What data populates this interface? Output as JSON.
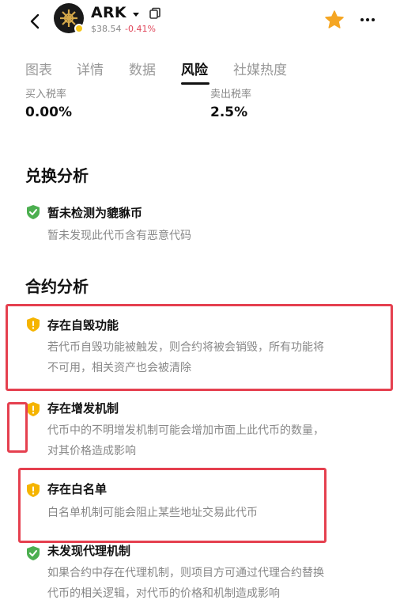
{
  "header": {
    "token_name": "ARK",
    "price": "$38.54",
    "change": "-0.41%",
    "colors": {
      "star": "#f5a623",
      "negative": "#e0465a",
      "shield_warn": "#f5b400",
      "shield_ok": "#4caf50",
      "annotation": "#e5404f"
    }
  },
  "tabs": [
    {
      "label": "图表"
    },
    {
      "label": "详情"
    },
    {
      "label": "数据"
    },
    {
      "label": "风险"
    },
    {
      "label": "社媒热度"
    }
  ],
  "tax": {
    "buy_label": "买入税率",
    "buy_value": "0.00%",
    "sell_label": "卖出税率",
    "sell_value": "2.5%"
  },
  "exchange_analysis": {
    "title": "兑换分析",
    "items": [
      {
        "status": "ok",
        "title": "暂未检测为貔貅币",
        "desc": [
          "暂未发现此代币含有恶意代码"
        ]
      }
    ]
  },
  "contract_analysis": {
    "title": "合约分析",
    "items": [
      {
        "status": "warn",
        "title": "存在自毁功能",
        "desc": [
          "若代币自毁功能被触发，则合约将被会销毁，所有功能将",
          "不可用，相关资产也会被清除"
        ]
      },
      {
        "status": "warn",
        "title": "存在增发机制",
        "desc": [
          "代币中的不明增发机制可能会增加市面上此代币的数量，",
          "对其价格造成影响"
        ]
      },
      {
        "status": "warn",
        "title": "存在白名单",
        "desc": [
          "白名单机制可能会阻止某些地址交易此代币"
        ]
      },
      {
        "status": "ok",
        "title": "未发现代理机制",
        "desc": [
          "如果合约中存在代理机制，则项目方可通过代理合约替换",
          "代币的相关逻辑，对代币的价格和机制造成影响"
        ]
      }
    ]
  }
}
